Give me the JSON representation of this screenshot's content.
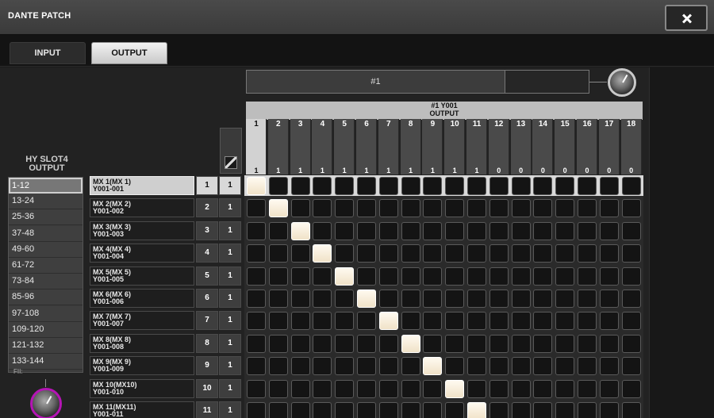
{
  "window": {
    "title": "DANTE PATCH"
  },
  "tabs": [
    {
      "label": "INPUT"
    },
    {
      "label": "OUTPUT"
    }
  ],
  "selector": {
    "name_display": "#1"
  },
  "header": {
    "slot_label": "#1 Y001",
    "output_label": "OUTPUT"
  },
  "left_header": {
    "label": "HY SLOT4\nOUTPUT"
  },
  "columns": [
    {
      "num": "1",
      "count": "1"
    },
    {
      "num": "2",
      "count": "1"
    },
    {
      "num": "3",
      "count": "1"
    },
    {
      "num": "4",
      "count": "1"
    },
    {
      "num": "5",
      "count": "1"
    },
    {
      "num": "6",
      "count": "1"
    },
    {
      "num": "7",
      "count": "1"
    },
    {
      "num": "8",
      "count": "1"
    },
    {
      "num": "9",
      "count": "1"
    },
    {
      "num": "10",
      "count": "1"
    },
    {
      "num": "11",
      "count": "1"
    },
    {
      "num": "12",
      "count": "0"
    },
    {
      "num": "13",
      "count": "0"
    },
    {
      "num": "14",
      "count": "0"
    },
    {
      "num": "15",
      "count": "0"
    },
    {
      "num": "16",
      "count": "0"
    },
    {
      "num": "17",
      "count": "0"
    },
    {
      "num": "18",
      "count": "0"
    }
  ],
  "ranges": [
    {
      "label": "1-12"
    },
    {
      "label": "13-24"
    },
    {
      "label": "25-36"
    },
    {
      "label": "37-48"
    },
    {
      "label": "49-60"
    },
    {
      "label": "61-72"
    },
    {
      "label": "73-84"
    },
    {
      "label": "85-96"
    },
    {
      "label": "97-108"
    },
    {
      "label": "109-120"
    },
    {
      "label": "121-132"
    },
    {
      "label": "133-144"
    }
  ],
  "range_scroll_label": "FII:",
  "rows": [
    {
      "name": "MX 1(MX 1)",
      "port": "Y001-001",
      "num": "1",
      "count": "1"
    },
    {
      "name": "MX 2(MX 2)",
      "port": "Y001-002",
      "num": "2",
      "count": "1"
    },
    {
      "name": "MX 3(MX 3)",
      "port": "Y001-003",
      "num": "3",
      "count": "1"
    },
    {
      "name": "MX 4(MX 4)",
      "port": "Y001-004",
      "num": "4",
      "count": "1"
    },
    {
      "name": "MX 5(MX 5)",
      "port": "Y001-005",
      "num": "5",
      "count": "1"
    },
    {
      "name": "MX 6(MX 6)",
      "port": "Y001-006",
      "num": "6",
      "count": "1"
    },
    {
      "name": "MX 7(MX 7)",
      "port": "Y001-007",
      "num": "7",
      "count": "1"
    },
    {
      "name": "MX 8(MX 8)",
      "port": "Y001-008",
      "num": "8",
      "count": "1"
    },
    {
      "name": "MX 9(MX 9)",
      "port": "Y001-009",
      "num": "9",
      "count": "1"
    },
    {
      "name": "MX 10(MX10)",
      "port": "Y001-010",
      "num": "10",
      "count": "1"
    },
    {
      "name": "MX 11(MX11)",
      "port": "Y001-011",
      "num": "11",
      "count": "1"
    }
  ],
  "patched_column_per_row": [
    1,
    2,
    3,
    4,
    5,
    6,
    7,
    8,
    9,
    10,
    11
  ],
  "selected_row": 1,
  "selected_column": 1,
  "selected_range": "1-12",
  "colors": {
    "patch_on": "#fffaf0",
    "patch_off": "#141414",
    "knob_ring_bottom": "#b514b5",
    "title_bar": "#444444"
  },
  "icons": {
    "close": "close-icon",
    "corner": "diagonal-patch-icon"
  }
}
